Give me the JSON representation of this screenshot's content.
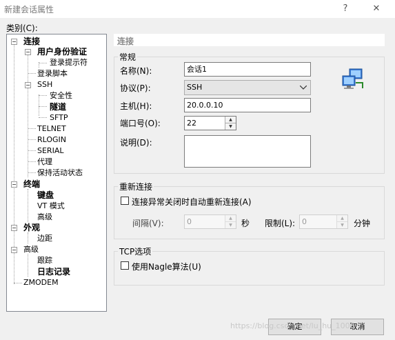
{
  "window": {
    "title": "新建会话属性",
    "help": "?",
    "close": "✕"
  },
  "category_label": "类别(C):",
  "tree": [
    {
      "label": "连接",
      "bold": true
    },
    {
      "label": "用户身份验证",
      "bold": true
    },
    {
      "label": "登录提示符",
      "bold": false
    },
    {
      "label": "登录脚本",
      "bold": false
    },
    {
      "label": "SSH",
      "bold": false
    },
    {
      "label": "安全性",
      "bold": false
    },
    {
      "label": "隧道",
      "bold": true
    },
    {
      "label": "SFTP",
      "bold": false
    },
    {
      "label": "TELNET",
      "bold": false
    },
    {
      "label": "RLOGIN",
      "bold": false
    },
    {
      "label": "SERIAL",
      "bold": false
    },
    {
      "label": "代理",
      "bold": false
    },
    {
      "label": "保持活动状态",
      "bold": false
    },
    {
      "label": "终端",
      "bold": true
    },
    {
      "label": "键盘",
      "bold": true
    },
    {
      "label": "VT 模式",
      "bold": false
    },
    {
      "label": "高级",
      "bold": false
    },
    {
      "label": "外观",
      "bold": true
    },
    {
      "label": "边距",
      "bold": false
    },
    {
      "label": "高级",
      "bold": false
    },
    {
      "label": "跟踪",
      "bold": false
    },
    {
      "label": "日志记录",
      "bold": true
    },
    {
      "label": "ZMODEM",
      "bold": false
    }
  ],
  "tree_toggle": "−",
  "panel_title": "连接",
  "general": {
    "legend": "常规",
    "name_label": "名称(N):",
    "name_value": "会话1",
    "protocol_label": "协议(P):",
    "protocol_value": "SSH",
    "host_label": "主机(H):",
    "host_value": "20.0.0.10",
    "port_label": "端口号(O):",
    "port_value": "22",
    "desc_label": "说明(D):",
    "desc_value": ""
  },
  "reconnect": {
    "legend": "重新连接",
    "checkbox_label": "连接异常关闭时自动重新连接(A)",
    "interval_label": "间隔(V):",
    "interval_value": "0",
    "interval_unit": "秒",
    "limit_label": "限制(L):",
    "limit_value": "0",
    "limit_unit": "分钟"
  },
  "tcp": {
    "legend": "TCP选项",
    "checkbox_label": "使用Nagle算法(U)"
  },
  "buttons": {
    "ok": "确定",
    "cancel": "取消"
  },
  "watermark": "https://blog.csdn.net/lu_hu_1006"
}
